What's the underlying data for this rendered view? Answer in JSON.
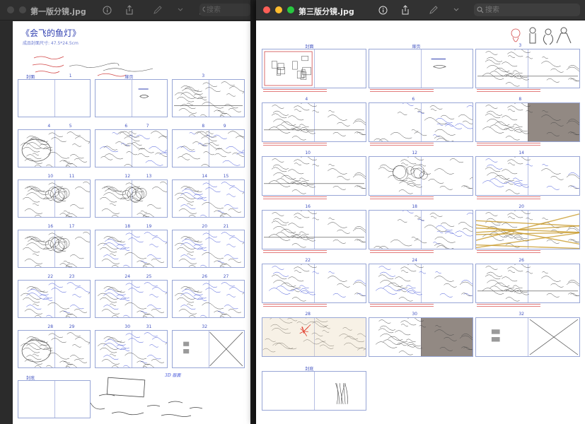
{
  "left_window": {
    "title": "第一版分镜.jpg",
    "search_placeholder": "搜索",
    "doc_title": "《会飞的鱼灯》",
    "doc_subtitle": "成品封面尺寸: 47.5*24.5cm",
    "thumbs": [
      {
        "num": "",
        "num2": "1",
        "label": "封面",
        "ink": "none"
      },
      {
        "num": "扉页",
        "num2": "",
        "label": "",
        "ink": "title"
      },
      {
        "num": "3",
        "num2": "",
        "label": "",
        "ink": "town"
      },
      {
        "num": "4",
        "num2": "5",
        "label": "",
        "ink": "fish"
      },
      {
        "num": "6",
        "num2": "7",
        "label": "",
        "ink": "mix"
      },
      {
        "num": "8",
        "num2": "9",
        "label": "",
        "ink": "mix"
      },
      {
        "num": "10",
        "num2": "11",
        "label": "",
        "ink": "tree"
      },
      {
        "num": "12",
        "num2": "13",
        "label": "",
        "ink": "tree"
      },
      {
        "num": "14",
        "num2": "15",
        "label": "",
        "ink": "blue"
      },
      {
        "num": "16",
        "num2": "17",
        "label": "",
        "ink": "tree"
      },
      {
        "num": "18",
        "num2": "19",
        "label": "",
        "ink": "blue"
      },
      {
        "num": "20",
        "num2": "21",
        "label": "",
        "ink": "blue"
      },
      {
        "num": "22",
        "num2": "23",
        "label": "",
        "ink": "blue"
      },
      {
        "num": "24",
        "num2": "25",
        "label": "",
        "ink": "blue"
      },
      {
        "num": "26",
        "num2": "27",
        "label": "",
        "ink": "blue"
      },
      {
        "num": "28",
        "num2": "29",
        "label": "",
        "ink": "fish"
      },
      {
        "num": "30",
        "num2": "31",
        "label": "",
        "ink": "blue"
      },
      {
        "num": "32",
        "num2": "",
        "label": "",
        "ink": "cross"
      },
      {
        "num": "",
        "num2": "",
        "label": "封底",
        "ink": "none"
      }
    ],
    "notes": [
      "3D 版面",
      "尾页"
    ]
  },
  "right_window": {
    "title": "第三版分镜.jpg",
    "search_placeholder": "搜索",
    "thumbs": [
      {
        "num": "封面",
        "ink": "cover"
      },
      {
        "num": "扉页",
        "ink": "title"
      },
      {
        "num": "3",
        "ink": "town"
      },
      {
        "num": "4",
        "ink": "town"
      },
      {
        "num": "6",
        "ink": "mix"
      },
      {
        "num": "8",
        "ink": "dark"
      },
      {
        "num": "10",
        "ink": "town"
      },
      {
        "num": "12",
        "ink": "tree"
      },
      {
        "num": "14",
        "ink": "blue"
      },
      {
        "num": "16",
        "ink": "town"
      },
      {
        "num": "18",
        "ink": "mix"
      },
      {
        "num": "20",
        "ink": "gold"
      },
      {
        "num": "22",
        "ink": "blue"
      },
      {
        "num": "24",
        "ink": "blue"
      },
      {
        "num": "26",
        "ink": "town"
      },
      {
        "num": "28",
        "ink": "fireworks"
      },
      {
        "num": "30",
        "ink": "dark"
      },
      {
        "num": "32",
        "ink": "cross"
      },
      {
        "num": "封底",
        "ink": "last"
      }
    ]
  },
  "colors": {
    "frame": "#98a6d6",
    "blue_ink": "#3f51d8",
    "red_ink": "#d24848",
    "pencil": "#444444"
  }
}
